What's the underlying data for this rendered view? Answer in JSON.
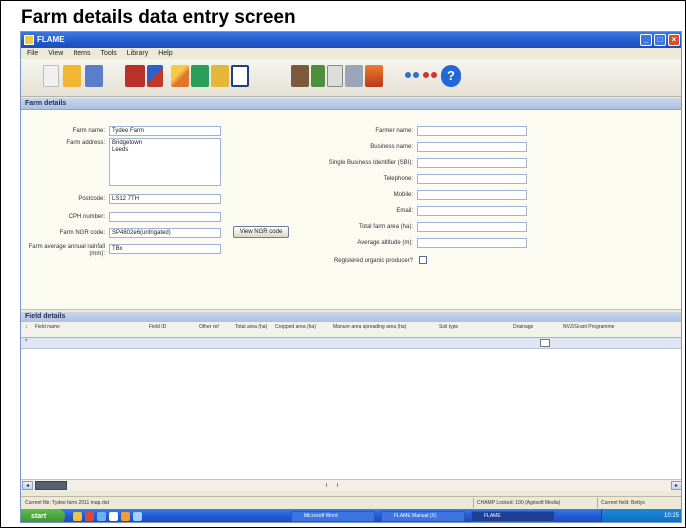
{
  "caption": "Farm details data entry screen",
  "window": {
    "title": "FLAME"
  },
  "menu": [
    "File",
    "View",
    "Items",
    "Tools",
    "Library",
    "Help"
  ],
  "farm_section": {
    "header": "Farm details"
  },
  "left_form": {
    "farm_name": {
      "label": "Farm name:",
      "value": "Tydee Farm"
    },
    "farm_address": {
      "label": "Farm address:",
      "value": "Bridgetown\nLeeds"
    },
    "postcode": {
      "label": "Postcode:",
      "value": "LS12 7TH"
    },
    "cph": {
      "label": "CPH number:",
      "value": ""
    },
    "os_grid": {
      "label": "Farm NGR code:",
      "value": "SP4802e6(unfrigated)"
    },
    "os_grid_btn": "View NGR code",
    "rainfall": {
      "label": "Farm average annual rainfall (mm):",
      "value": "TBx"
    }
  },
  "right_form": {
    "farmer_name": {
      "label": "Farmer name:",
      "value": ""
    },
    "business_name": {
      "label": "Business name:",
      "value": ""
    },
    "sbi": {
      "label": "Single Business Identifier (SBI):",
      "value": ""
    },
    "telephone": {
      "label": "Telephone:",
      "value": ""
    },
    "mobile": {
      "label": "Mobile:",
      "value": ""
    },
    "email": {
      "label": "Email:",
      "value": ""
    },
    "total_area": {
      "label": "Total farm area (ha):",
      "value": ""
    },
    "arable_area": {
      "label": "Average altitude (m):",
      "value": ""
    },
    "organic": {
      "label": "Registered organic producer?",
      "checked": false
    }
  },
  "fields_section": {
    "header": "Field details",
    "columns": [
      "Field name",
      "Field ID",
      "Other ref",
      "Total area (ha)",
      "Cropped area (ha)",
      "Manure area spreading area (ha)",
      "Soil type",
      "Drainage",
      "NVZ/Grant Programme"
    ]
  },
  "statusbar": {
    "left": "Current file: Tydee farm 2011 map.rbd",
    "right1": "CHAMP Locked: 100 (Agrisoft Media)",
    "right2": "Current field: Bettys"
  },
  "taskbar": {
    "start": "start",
    "tasks": [
      "Microsoft Word",
      "FLAME Manual (X)",
      "FLAME"
    ],
    "clock": "10:25"
  }
}
